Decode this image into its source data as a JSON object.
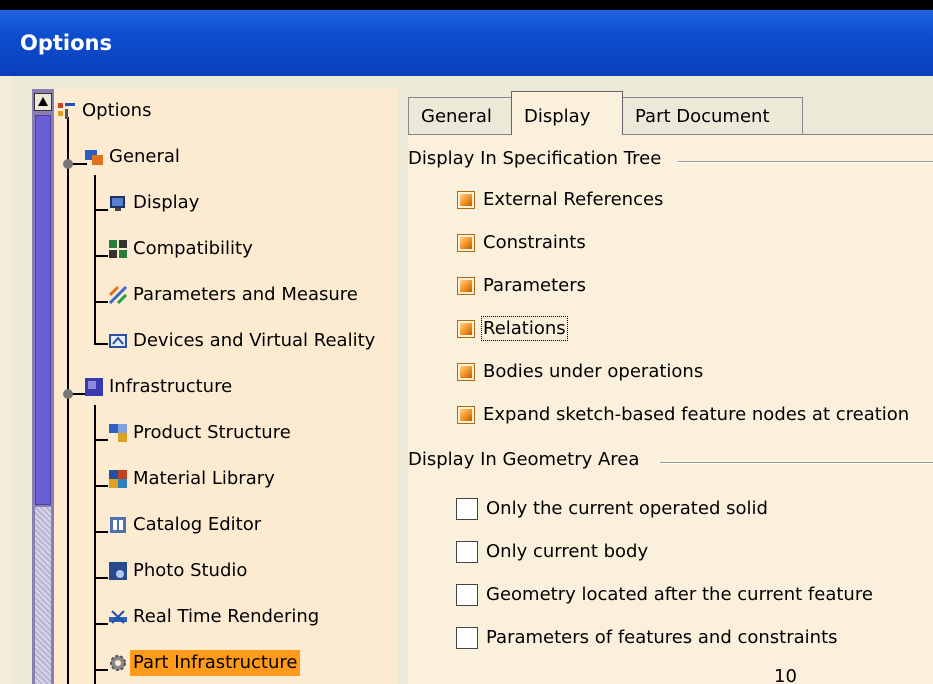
{
  "window": {
    "title": "Options"
  },
  "tree": {
    "root": "Options",
    "items": [
      {
        "label": "General",
        "icon": "general-icon"
      },
      {
        "label": "Display",
        "icon": "display-icon"
      },
      {
        "label": "Compatibility",
        "icon": "compatibility-icon"
      },
      {
        "label": "Parameters and Measure",
        "icon": "parameters-measure-icon"
      },
      {
        "label": "Devices and Virtual Reality",
        "icon": "devices-vr-icon"
      },
      {
        "label": "Infrastructure",
        "icon": "infrastructure-icon"
      },
      {
        "label": "Product Structure",
        "icon": "product-structure-icon"
      },
      {
        "label": "Material Library",
        "icon": "material-library-icon"
      },
      {
        "label": "Catalog Editor",
        "icon": "catalog-editor-icon"
      },
      {
        "label": "Photo Studio",
        "icon": "photo-studio-icon"
      },
      {
        "label": "Real Time Rendering",
        "icon": "real-time-rendering-icon"
      },
      {
        "label": "Part Infrastructure",
        "icon": "gear-icon",
        "selected": true
      }
    ]
  },
  "tabs": [
    {
      "label": "General"
    },
    {
      "label": "Display",
      "active": true
    },
    {
      "label": "Part Document"
    }
  ],
  "spec_tree": {
    "title": "Display In Specification Tree",
    "options": [
      {
        "label": "External References",
        "checked": true
      },
      {
        "label": "Constraints",
        "checked": true
      },
      {
        "label": "Parameters",
        "checked": true
      },
      {
        "label": "Relations",
        "checked": true,
        "focused": true
      },
      {
        "label": "Bodies under operations",
        "checked": true
      },
      {
        "label": "Expand sketch-based feature nodes at creation",
        "checked": true
      }
    ]
  },
  "geometry_area": {
    "title": "Display In Geometry Area",
    "options": [
      {
        "label": "Only the current operated solid",
        "checked": false
      },
      {
        "label": "Only current body",
        "checked": false
      },
      {
        "label": "Geometry located after the current feature",
        "checked": false
      },
      {
        "label": "Parameters of features and constraints",
        "checked": false
      }
    ],
    "partial_value": "10"
  },
  "colors": {
    "title_bar": "#0d4fd0",
    "tree_bg": "#fcebd0",
    "selection": "#ff9a1a",
    "panel_bg": "#fbf0dc"
  }
}
